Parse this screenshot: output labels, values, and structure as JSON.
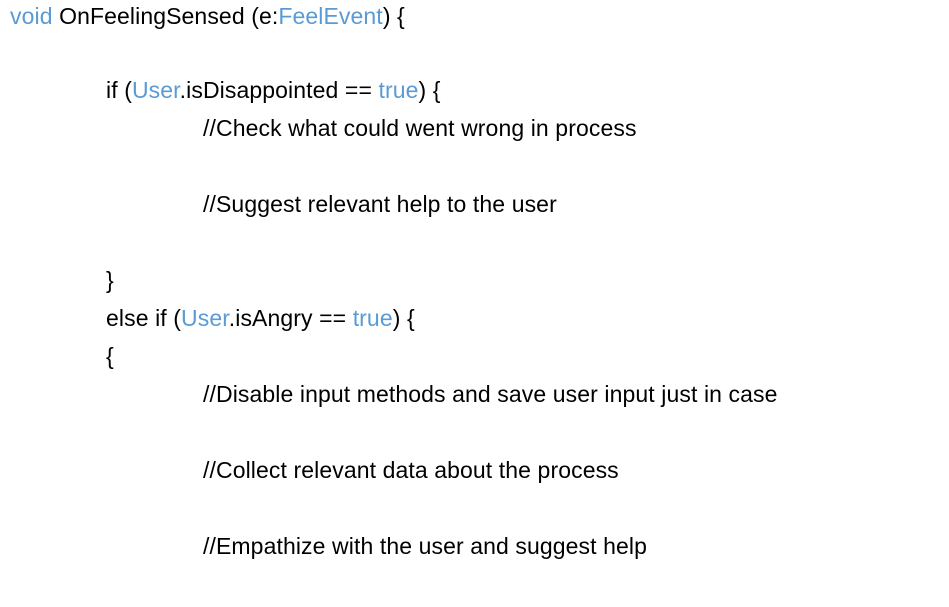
{
  "colors": {
    "keyword": "#5b9bd5",
    "text": "#000000",
    "background": "#ffffff"
  },
  "code": {
    "signature": {
      "keyword_void": "void",
      "method_name": " OnFeelingSensed (e:",
      "type_name": "FeelEvent",
      "tail": ") {"
    },
    "if_line": {
      "prefix": "if (",
      "object": "User",
      "member": ".isDisappointed == ",
      "value": "true",
      "suffix": ") {"
    },
    "comment_check": "//Check what could went wrong in process",
    "comment_suggest": "//Suggest relevant help to the user",
    "close_brace": "}",
    "else_if_line": {
      "prefix": "else if (",
      "object": "User",
      "member": ".isAngry == ",
      "value": "true",
      "suffix": ") {"
    },
    "open_brace": "{",
    "comment_disable": "//Disable input methods and save user input just in case",
    "comment_collect": "//Collect relevant data about the process",
    "comment_empathize": "//Empathize with the user and suggest help"
  }
}
